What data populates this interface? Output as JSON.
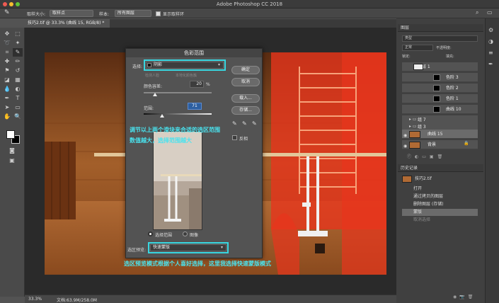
{
  "window": {
    "title": "Adobe Photoshop CC 2018"
  },
  "options": {
    "sample_size_label": "取样大小:",
    "sample_size_value": "取样点",
    "sample_label": "样本:",
    "sample_value": "所有图层",
    "show_ring_label": "显示取样环"
  },
  "document": {
    "tab_label": "技巧2.tif @ 33.3% (曲线 15, RGB/8) *",
    "zoom": "33.3%",
    "doc_size": "文档:63.9M/258.0M"
  },
  "dialog": {
    "title": "色彩范围",
    "select_label": "选择:",
    "select_value": "阴影",
    "detect_faces": "检测人脸",
    "localized": "本地化颜色簇",
    "fuzziness_label": "颜色容差:",
    "fuzziness_value": "20",
    "fuzziness_unit": "%",
    "range_label": "范围:",
    "range_value": "71",
    "invert_label": "反相",
    "ok": "确定",
    "cancel": "取消",
    "load": "载入...",
    "save": "存储...",
    "radio_selection": "选择范围",
    "radio_image": "图像",
    "preview_label": "选区预览:",
    "preview_value": "快速蒙版"
  },
  "annotations": {
    "line1": "调节以上两个滑块来合适的选区范围",
    "line2": "数值越大，选择范围越大",
    "line3": "选区预览模式根据个人喜好选择，这里我选择快速蒙版模式"
  },
  "layers_panel": {
    "title": "图层",
    "kind_label": "类型",
    "mode_value": "正常",
    "opacity_label": "不透明度:",
    "fill_label": "填充:",
    "lock_label": "锁定:",
    "items": [
      {
        "name": "图层 1"
      },
      {
        "name": "色阶 3"
      },
      {
        "name": "色阶 2"
      },
      {
        "name": "色阶 1"
      },
      {
        "name": "曲线 10"
      },
      {
        "name": "组 7"
      },
      {
        "name": "组 3"
      },
      {
        "name": "曲线 15"
      },
      {
        "name": "背景"
      }
    ]
  },
  "history_panel": {
    "title": "历史记录",
    "snapshot": "技巧2.tif",
    "items": [
      "打开",
      "通过拷贝的图层",
      "删除图层 (存储)",
      "蒙版",
      "取消选择"
    ]
  },
  "colors": {
    "accent": "#38d6e0",
    "annotation": "#49e3ef",
    "mask_red": "#e8341c"
  }
}
